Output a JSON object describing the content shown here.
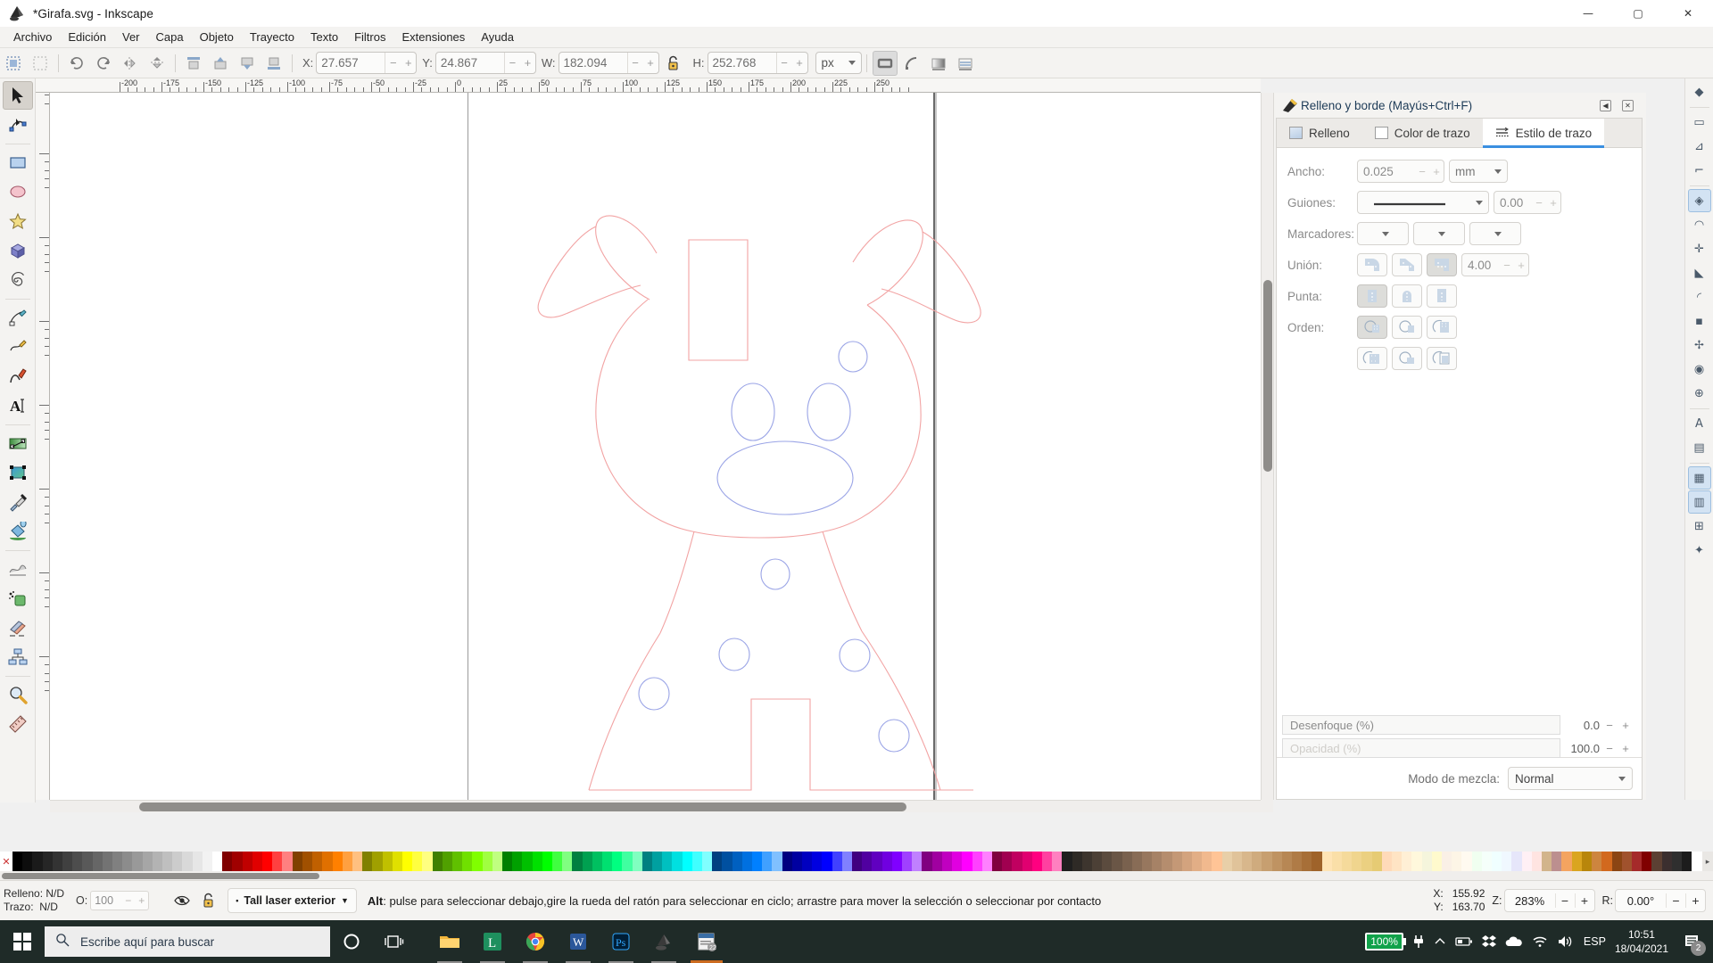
{
  "window": {
    "title": "*Girafa.svg - Inkscape",
    "minimize": "—",
    "maximize": "▢",
    "close": "✕"
  },
  "menu": {
    "items": [
      "Archivo",
      "Edición",
      "Ver",
      "Capa",
      "Objeto",
      "Trayecto",
      "Texto",
      "Filtros",
      "Extensiones",
      "Ayuda"
    ]
  },
  "toolcontrols": {
    "x_label": "X:",
    "x_value": "27.657",
    "y_label": "Y:",
    "y_value": "24.867",
    "w_label": "W:",
    "w_value": "182.094",
    "h_label": "H:",
    "h_value": "252.768",
    "unit": "px",
    "lock_icon": "unlocked-padlock-icon",
    "minus": "−",
    "plus": "+"
  },
  "toolbox": {
    "tools": [
      {
        "name": "selector-tool",
        "icon": "arrow-pointer-icon",
        "active": true
      },
      {
        "name": "node-tool",
        "icon": "node-editor-icon",
        "active": false
      },
      {
        "name": "rectangle-tool",
        "icon": "rectangle-icon",
        "active": false
      },
      {
        "name": "ellipse-tool",
        "icon": "ellipse-icon",
        "active": false
      },
      {
        "name": "star-tool",
        "icon": "star-icon",
        "active": false
      },
      {
        "name": "3dbox-tool",
        "icon": "cube-icon",
        "active": false
      },
      {
        "name": "spiral-tool",
        "icon": "spiral-icon",
        "active": false
      },
      {
        "name": "pencil-tool",
        "icon": "pencil-icon",
        "active": false
      },
      {
        "name": "bezier-tool",
        "icon": "bezier-pen-icon",
        "active": false
      },
      {
        "name": "calligraphy-tool",
        "icon": "calligraphy-pen-icon",
        "active": false
      },
      {
        "name": "text-tool",
        "icon": "text-a-icon",
        "active": false
      },
      {
        "name": "gradient-tool",
        "icon": "gradient-icon",
        "active": false
      },
      {
        "name": "mesh-tool",
        "icon": "mesh-gradient-icon",
        "active": false
      },
      {
        "name": "dropper-tool",
        "icon": "eyedropper-icon",
        "active": false
      },
      {
        "name": "paintbucket-tool",
        "icon": "paint-bucket-icon",
        "active": false
      },
      {
        "name": "tweak-tool",
        "icon": "tweak-wave-icon",
        "active": false
      },
      {
        "name": "spray-tool",
        "icon": "spray-can-icon",
        "active": false
      },
      {
        "name": "eraser-tool",
        "icon": "eraser-icon",
        "active": false
      },
      {
        "name": "connector-tool",
        "icon": "connector-diagram-icon",
        "active": false
      },
      {
        "name": "zoom-tool",
        "icon": "magnifier-icon",
        "active": false
      },
      {
        "name": "measure-tool",
        "icon": "ruler-measure-icon",
        "active": false
      }
    ]
  },
  "rulers": {
    "horizontal_labels": [
      "-200",
      "-175",
      "-150",
      "-125",
      "-100",
      "-75",
      "-50",
      "-25",
      "0",
      "25",
      "50",
      "75",
      "100",
      "125",
      "150",
      "175",
      "200",
      "225",
      "250"
    ],
    "vertical_labels": [
      "50",
      "100",
      "150",
      "200",
      "250",
      "300",
      "350",
      "400"
    ]
  },
  "dock": {
    "title": "Relleno y borde (Mayús+Ctrl+F)",
    "collapse_icon": "collapse-left-icon",
    "close_icon": "close-dialog-icon",
    "tabs": [
      {
        "label": "Relleno",
        "icon": "fill-swatch-icon",
        "active": false
      },
      {
        "label": "Color de trazo",
        "icon": "stroke-swatch-icon",
        "active": false
      },
      {
        "label": "Estilo de trazo",
        "icon": "stroke-style-icon",
        "active": true
      }
    ],
    "rows": {
      "width_label": "Ancho:",
      "width_value": "0.025",
      "width_unit": "mm",
      "dashes_label": "Guiones:",
      "dashes_pattern": "solid-line",
      "dashes_offset": "0.00",
      "markers_label": "Marcadores:",
      "join_label": "Unión:",
      "join_miter": "4.00",
      "cap_label": "Punta:",
      "order_label": "Orden:"
    },
    "blend_label": "Modo de mezcla:",
    "blend_value": "Normal",
    "blur_label": "Desenfoque (%)",
    "blur_value": "0.0",
    "opacity_label": "Opacidad (%)",
    "opacity_value": "100.0",
    "minus": "−",
    "plus": "+"
  },
  "snapbar": {
    "items": [
      {
        "name": "snap-enable-toggle",
        "icon": "magnet-icon",
        "on": false
      },
      {
        "name": "snap-bounding-box",
        "icon": "bbox-snap-icon",
        "on": false
      },
      {
        "name": "snap-bbox-edge",
        "icon": "bbox-edge-icon",
        "on": false
      },
      {
        "name": "snap-bbox-corner",
        "icon": "bbox-corner-icon",
        "on": false
      },
      {
        "name": "snap-nodes",
        "icon": "node-snap-icon",
        "on": true
      },
      {
        "name": "snap-paths",
        "icon": "path-snap-icon",
        "on": false
      },
      {
        "name": "snap-path-intersections",
        "icon": "path-intersect-icon",
        "on": false
      },
      {
        "name": "snap-cusp-nodes",
        "icon": "cusp-node-icon",
        "on": false
      },
      {
        "name": "snap-smooth-nodes",
        "icon": "smooth-node-icon",
        "on": false
      },
      {
        "name": "snap-midpoints",
        "icon": "midpoint-icon",
        "on": false
      },
      {
        "name": "snap-bbox-center",
        "icon": "bbox-center-icon",
        "on": false
      },
      {
        "name": "snap-object-center",
        "icon": "object-center-icon",
        "on": false
      },
      {
        "name": "snap-rotation-center",
        "icon": "rotation-center-icon",
        "on": false
      },
      {
        "name": "snap-text-baseline",
        "icon": "text-baseline-icon",
        "on": false
      },
      {
        "name": "snap-page-border",
        "icon": "page-border-icon",
        "on": false
      },
      {
        "name": "snap-grid",
        "icon": "grid-icon",
        "on": true
      },
      {
        "name": "snap-guides",
        "icon": "guides-icon",
        "on": true
      },
      {
        "name": "snap-grid-guide-intersections",
        "icon": "grid-guide-intersect-icon",
        "on": false
      },
      {
        "name": "snap-extra",
        "icon": "extra-snap-icon",
        "on": false
      }
    ]
  },
  "palette": {
    "x_label": "✕",
    "arrow": "▸",
    "colors": [
      "#000000",
      "#0d0d0d",
      "#1a1a1a",
      "#262626",
      "#333333",
      "#404040",
      "#4d4d4d",
      "#595959",
      "#666666",
      "#737373",
      "#808080",
      "#8c8c8c",
      "#999999",
      "#a6a6a6",
      "#b3b3b3",
      "#bfbfbf",
      "#cccccc",
      "#d9d9d9",
      "#e6e6e6",
      "#f2f2f2",
      "#ffffff",
      "#800000",
      "#a00000",
      "#c00000",
      "#e00000",
      "#ff0000",
      "#ff4040",
      "#ff8080",
      "#804000",
      "#a05000",
      "#c06000",
      "#e07000",
      "#ff8000",
      "#ffa040",
      "#ffc080",
      "#808000",
      "#a0a000",
      "#c0c000",
      "#e0e000",
      "#ffff00",
      "#ffff40",
      "#ffff80",
      "#408000",
      "#50a000",
      "#60c000",
      "#70e000",
      "#80ff00",
      "#a0ff40",
      "#c0ff80",
      "#008000",
      "#00a000",
      "#00c000",
      "#00e000",
      "#00ff00",
      "#40ff40",
      "#80ff80",
      "#008040",
      "#00a050",
      "#00c060",
      "#00e070",
      "#00ff80",
      "#40ffa0",
      "#80ffc0",
      "#008080",
      "#00a0a0",
      "#00c0c0",
      "#00e0e0",
      "#00ffff",
      "#40ffff",
      "#80ffff",
      "#004080",
      "#0050a0",
      "#0060c0",
      "#0070e0",
      "#0080ff",
      "#40a0ff",
      "#80c0ff",
      "#000080",
      "#0000a0",
      "#0000c0",
      "#0000e0",
      "#0000ff",
      "#4040ff",
      "#8080ff",
      "#400080",
      "#5000a0",
      "#6000c0",
      "#7000e0",
      "#8000ff",
      "#a040ff",
      "#c080ff",
      "#800080",
      "#a000a0",
      "#c000c0",
      "#e000e0",
      "#ff00ff",
      "#ff40ff",
      "#ff80ff",
      "#800040",
      "#a00050",
      "#c00060",
      "#e00070",
      "#ff0080",
      "#ff40a0",
      "#ff80c0",
      "#1f1f1f",
      "#2e2a26",
      "#3d352e",
      "#4c4036",
      "#5b4b3e",
      "#6a5646",
      "#79614e",
      "#886c56",
      "#97775e",
      "#a68266",
      "#b58d6e",
      "#c49876",
      "#d3a37e",
      "#e2ae86",
      "#f1b98e",
      "#ffc496",
      "#e8cfa8",
      "#e0c39a",
      "#d8b78c",
      "#cfab7e",
      "#c79f70",
      "#bf9362",
      "#b78754",
      "#af7b46",
      "#a76f38",
      "#9f632a",
      "#ffe4b5",
      "#fadfa8",
      "#f5da9b",
      "#f0d58e",
      "#ebd081",
      "#e6cb74",
      "#ffdab9",
      "#ffe4c4",
      "#ffefd5",
      "#fff8dc",
      "#f5f5dc",
      "#fffacd",
      "#faf0e6",
      "#fdf5e6",
      "#fffaf0",
      "#f0fff0",
      "#f5fffa",
      "#f0ffff",
      "#f0f8ff",
      "#e6e6fa",
      "#fff0f5",
      "#ffe4e1",
      "#d2b48c",
      "#bc8f8f",
      "#f4a460",
      "#daa520",
      "#b8860b",
      "#cd853f",
      "#d2691e",
      "#8b4513",
      "#a0522d",
      "#a52a2a",
      "#800000",
      "#5c4033",
      "#3b2f2f",
      "#2f2f2f",
      "#1c1c1c",
      "#ffffff"
    ]
  },
  "status": {
    "fill_label": "Relleno:",
    "fill_value": "N/D",
    "stroke_label": "Trazo:",
    "stroke_value": "N/D",
    "opacity_label": "O:",
    "opacity_value": "100",
    "hide_icon": "hidden-eye-icon",
    "lock_icon": "layer-unlock-icon",
    "layer_name": "Tall laser exterior",
    "hint_prefix": "Alt",
    "hint_text": ": pulse para seleccionar debajo,gire la rueda del ratón para seleccionar en ciclo; arrastre para mover la selección o seleccionar por contacto",
    "x_label": "X:",
    "x_value": "155.92",
    "y_label": "Y:",
    "y_value": "163.70",
    "z_label": "Z:",
    "zoom_value": "283%",
    "r_label": "R:",
    "rotation_value": "0.00°",
    "minus": "−",
    "plus": "+"
  },
  "taskbar": {
    "start_icon": "windows-logo-icon",
    "search_placeholder": "Escribe aquí para buscar",
    "search_icon": "search-magnifier-icon",
    "cortana_icon": "cortana-circle-icon",
    "taskview_icon": "task-view-icon",
    "apps": [
      {
        "name": "file-explorer-icon",
        "open": true
      },
      {
        "name": "lightburn-icon",
        "open": true
      },
      {
        "name": "google-chrome-icon",
        "open": true
      },
      {
        "name": "microsoft-word-icon",
        "open": true
      },
      {
        "name": "adobe-photoshop-icon",
        "open": true
      },
      {
        "name": "inkscape-icon",
        "open": true
      },
      {
        "name": "pdf-reader-icon",
        "open": true,
        "active": true
      }
    ],
    "tray": {
      "battery_text": "100%",
      "plug_icon": "power-plug-icon",
      "chevron_icon": "show-hidden-icons-icon",
      "battery_icon": "battery-icon",
      "dropbox_icon": "dropbox-icon",
      "onedrive_icon": "onedrive-cloud-icon",
      "wifi_icon": "wifi-icon",
      "volume_icon": "speaker-volume-icon",
      "language": "ESP",
      "time": "10:51",
      "date": "18/04/2021",
      "notification_icon": "notification-center-icon",
      "notification_count": "2"
    }
  },
  "artwork": {
    "name": "giraffe-laser-cut-outline",
    "stroke_outer": "#f0a0a0",
    "stroke_inner": "#9aa0e8"
  }
}
